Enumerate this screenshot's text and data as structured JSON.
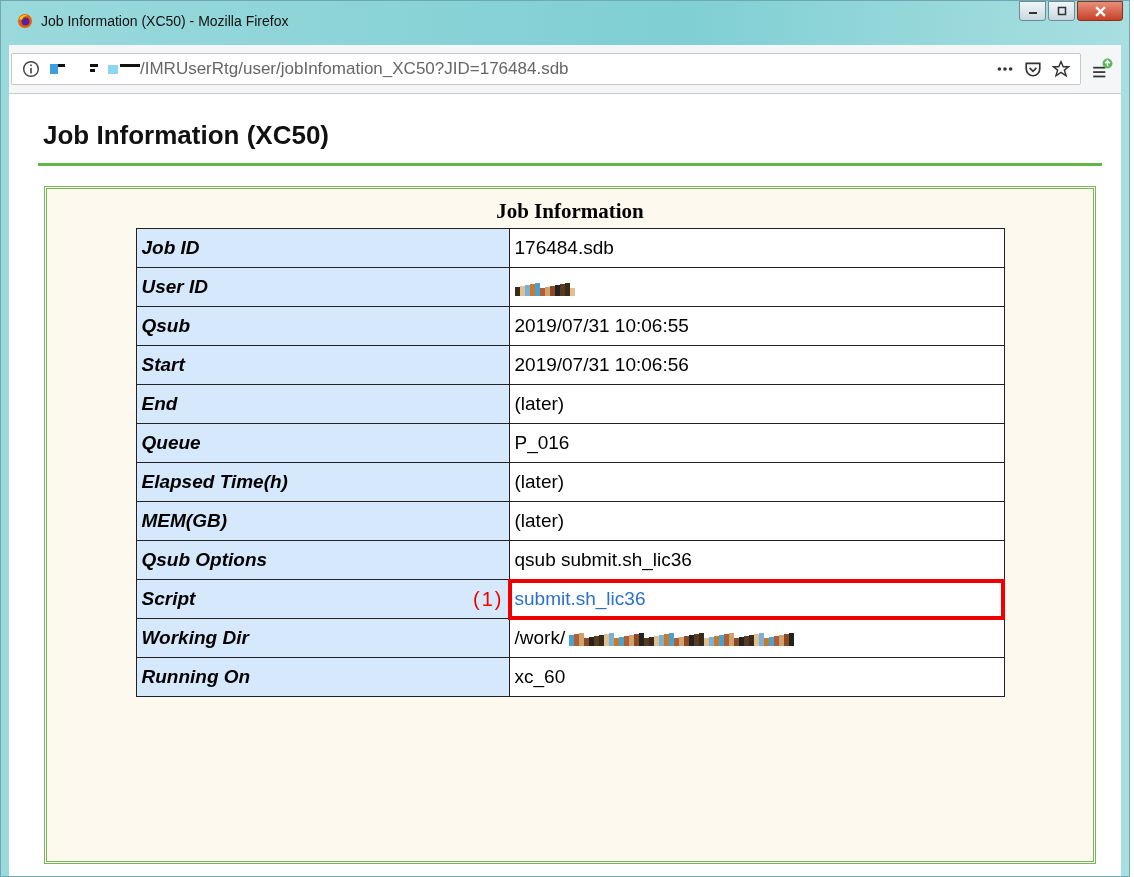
{
  "window": {
    "title": "Job Information (XC50) - Mozilla Firefox"
  },
  "address_bar": {
    "url": "/IMRUserRtg/user/jobInfomation_XC50?JID=176484.sdb",
    "host_redacted": true
  },
  "page": {
    "heading": "Job Information (XC50)"
  },
  "table": {
    "caption": "Job Information",
    "rows": [
      {
        "label": "Job ID",
        "kind": "text",
        "value": "176484.sdb",
        "highlighted": false
      },
      {
        "label": "User ID",
        "kind": "redacted",
        "highlighted": false
      },
      {
        "label": "Qsub",
        "kind": "text",
        "value": "2019/07/31 10:06:55",
        "highlighted": false
      },
      {
        "label": "Start",
        "kind": "text",
        "value": "2019/07/31 10:06:56",
        "highlighted": false
      },
      {
        "label": "End",
        "kind": "text",
        "value": "(later)",
        "highlighted": false
      },
      {
        "label": "Queue",
        "kind": "text",
        "value": "P_016",
        "highlighted": false
      },
      {
        "label": "Elapsed Time(h)",
        "kind": "text",
        "value": "(later)",
        "highlighted": false
      },
      {
        "label": "MEM(GB)",
        "kind": "text",
        "value": "(later)",
        "highlighted": false
      },
      {
        "label": "Qsub Options",
        "kind": "text",
        "value": "qsub submit.sh_lic36",
        "highlighted": false
      },
      {
        "label": "Script",
        "kind": "link",
        "value": "submit.sh_lic36",
        "highlighted": true,
        "callout": "(1)"
      },
      {
        "label": "Working Dir",
        "kind": "partly_redacted",
        "value": "/work/",
        "highlighted": false
      },
      {
        "label": "Running On",
        "kind": "text",
        "value": "xc_60",
        "highlighted": false
      }
    ]
  }
}
